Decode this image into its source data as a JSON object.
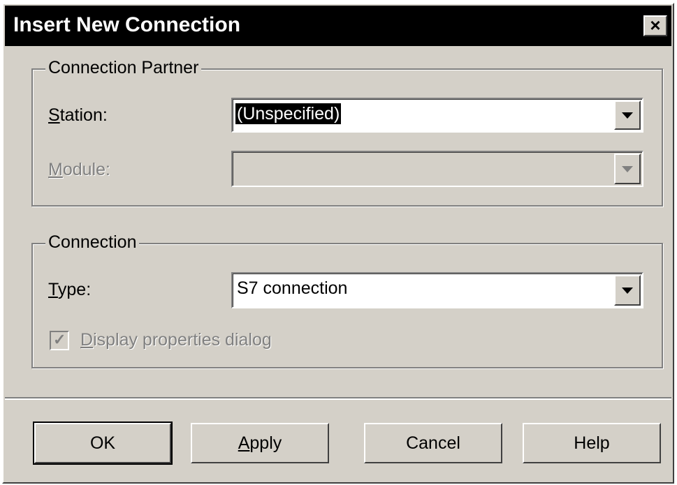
{
  "dialog": {
    "title": "Insert New Connection",
    "close_glyph": "×"
  },
  "partner_group": {
    "legend": "Connection Partner",
    "station": {
      "label_mnemonic": "S",
      "label_rest": "tation:",
      "value": "(Unspecified)"
    },
    "module": {
      "label_mnemonic": "M",
      "label_rest": "odule:",
      "value": ""
    }
  },
  "connection_group": {
    "legend": "Connection",
    "type": {
      "label_mnemonic": "T",
      "label_rest": "ype:",
      "value": "S7 connection"
    },
    "display_properties": {
      "label_mnemonic": "D",
      "label_rest": "isplay properties dialog",
      "checked": true,
      "check_glyph": "✓"
    }
  },
  "buttons": {
    "ok": "OK",
    "apply_mnemonic": "A",
    "apply_rest": "pply",
    "cancel": "Cancel",
    "help": "Help"
  }
}
